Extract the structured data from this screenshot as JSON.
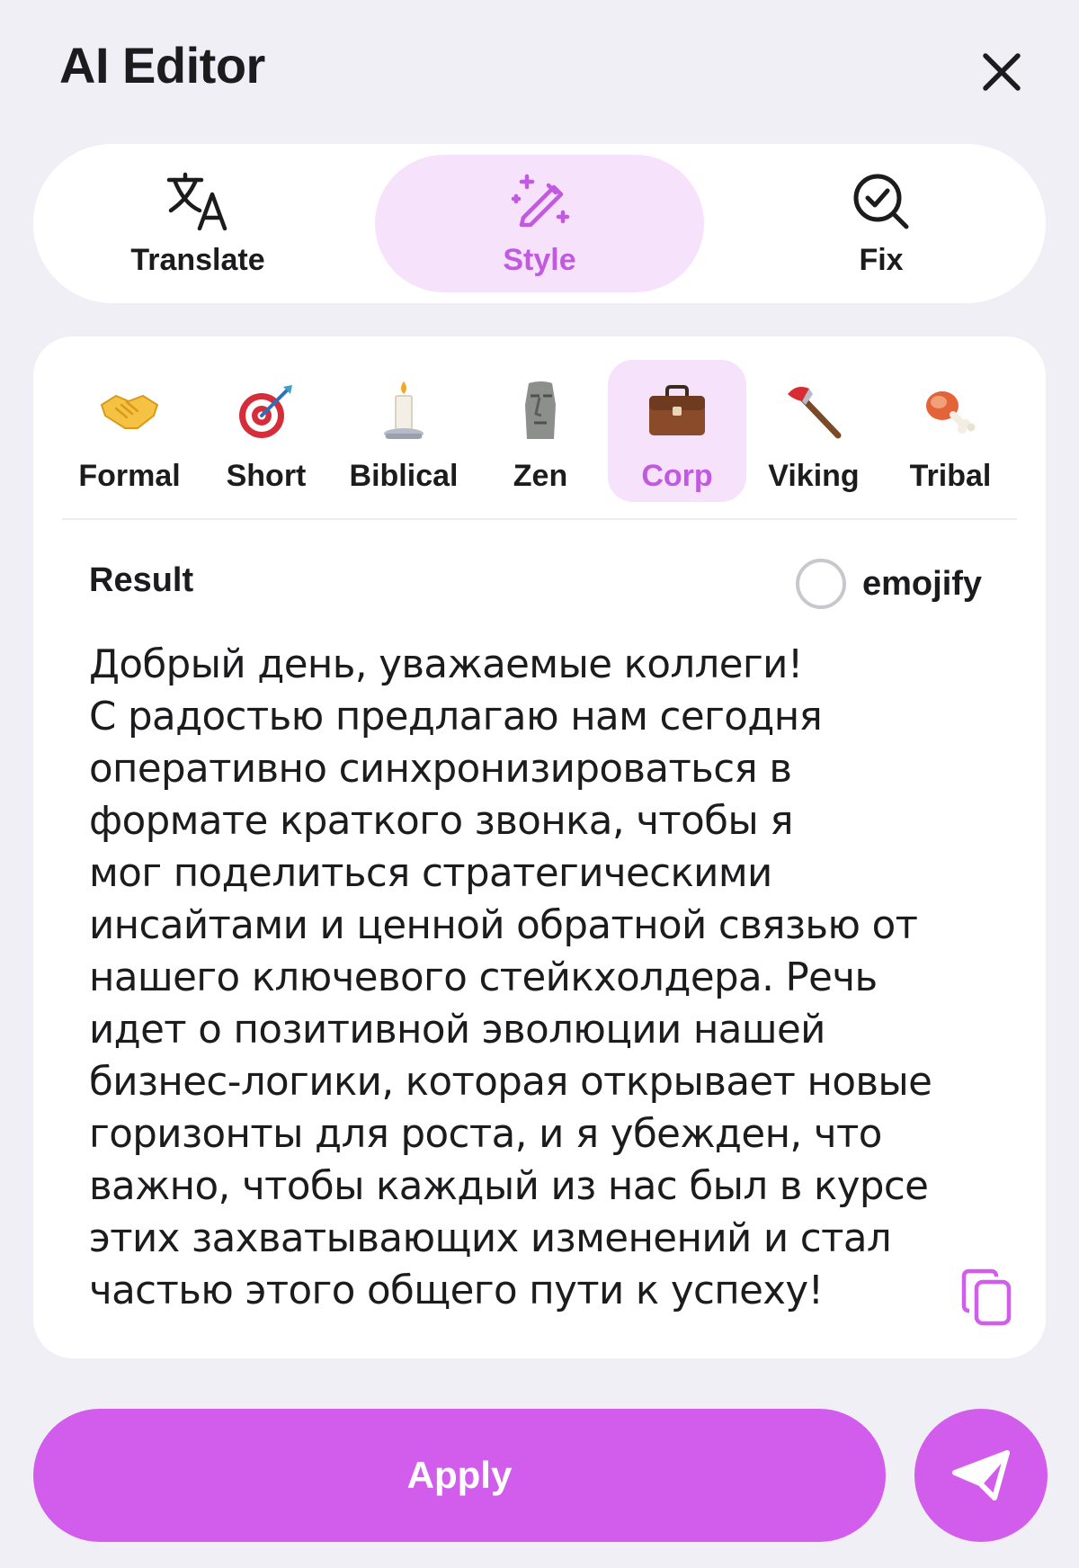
{
  "header": {
    "title": "AI Editor"
  },
  "modes": [
    {
      "label": "Translate",
      "icon": "translate-icon",
      "active": false
    },
    {
      "label": "Style",
      "icon": "magic-wand-icon",
      "active": true
    },
    {
      "label": "Fix",
      "icon": "search-check-icon",
      "active": false
    }
  ],
  "styles": [
    {
      "label": "Formal",
      "emoji": "🤝",
      "active": false
    },
    {
      "label": "Short",
      "emoji": "🎯",
      "active": false
    },
    {
      "label": "Biblical",
      "emoji": "🕯️",
      "active": false
    },
    {
      "label": "Zen",
      "emoji": "🗿",
      "active": false
    },
    {
      "label": "Corp",
      "emoji": "💼",
      "active": true
    },
    {
      "label": "Viking",
      "emoji": "🪓",
      "active": false
    },
    {
      "label": "Tribal",
      "emoji": "🍖",
      "active": false
    }
  ],
  "result": {
    "label": "Result",
    "emojify_label": "emojify",
    "emojify_checked": false,
    "text": "Добрый день, уважаемые коллеги!\nС радостью предлагаю нам сегодня\nоперативно синхронизироваться в\nформате краткого звонка, чтобы я\nмог поделиться стратегическими\nинсайтами и ценной обратной связью от\nнашего ключевого стейкхолдера. Речь\nидет о позитивной эволюции нашей\nбизнес-логики, которая открывает новые\nгоризонты для роста, и я убежден, что\nважно, чтобы каждый из нас был в курсе\nэтих захватывающих изменений и стал\nчастью этого общего пути к успеху!"
  },
  "actions": {
    "apply_label": "Apply"
  },
  "colors": {
    "accent": "#d25ded",
    "accent_text": "#c15ae0",
    "active_bg": "#f7e2fb",
    "background": "#f0eff6"
  }
}
